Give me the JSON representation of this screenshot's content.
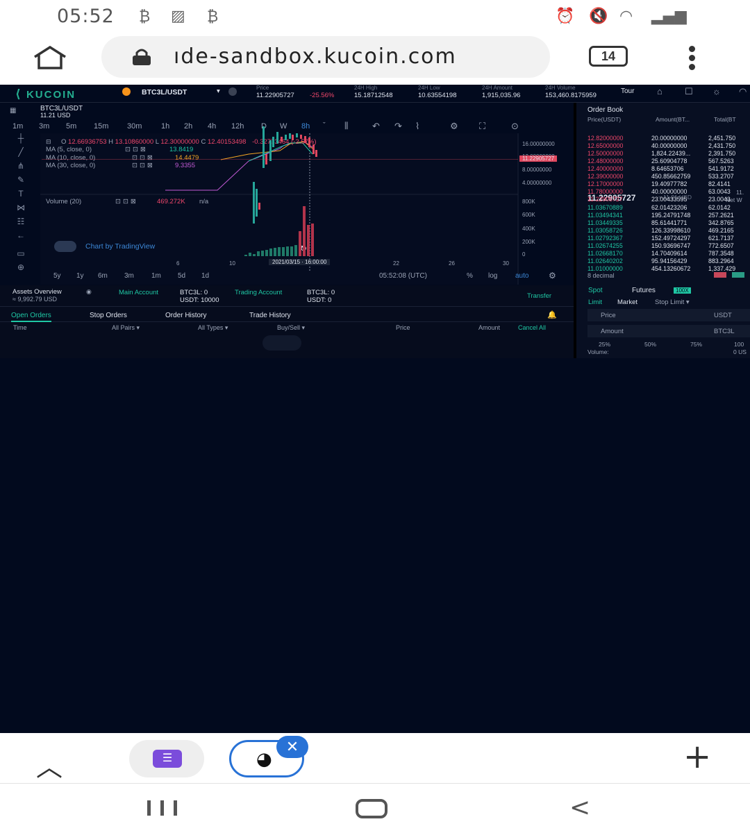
{
  "status_bar": {
    "time": "05:52",
    "icons": [
      "bitcoin-icon",
      "image-icon",
      "bitcoin-icon",
      "alarm-icon",
      "mute-icon",
      "wifi-icon",
      "signal-icon",
      "battery-icon"
    ]
  },
  "browser": {
    "url": "ıde-sandbox.kucoin.com",
    "tab_count": "14"
  },
  "header": {
    "brand": "KUCOIN",
    "pair": "BTC3L/USDT",
    "stats": [
      {
        "label": "Price",
        "value": "11.22905727",
        "change": "-25.56%"
      },
      {
        "label": "24H High",
        "value": "15.18712548"
      },
      {
        "label": "24H Low",
        "value": "10.63554198"
      },
      {
        "label": "24H Amount",
        "value": "1,915,035.96"
      },
      {
        "label": "24H Volume",
        "value": "153,460.8175959"
      }
    ],
    "tour": "Tour"
  },
  "chart": {
    "symbol": "BTC3L/USDT",
    "symbol_price": "11.21 USD",
    "intervals": [
      "1m",
      "3m",
      "5m",
      "15m",
      "30m",
      "1h",
      "2h",
      "4h",
      "12h",
      "D",
      "W",
      "8h"
    ],
    "active_interval": "8h",
    "ohlc": {
      "o": "12.66936753",
      "h": "13.10860000",
      "l": "12.30000000",
      "c": "12.40153498",
      "change": "-0.32773464 (-2.57%)"
    },
    "indicators": [
      {
        "label": "MA (5, close, 0)",
        "value": "13.8419",
        "color": "#1fc7a4"
      },
      {
        "label": "MA (10, close, 0)",
        "value": "14.4479",
        "color": "#f5a623"
      },
      {
        "label": "MA (30, close, 0)",
        "value": "9.3355",
        "color": "#c45bd6"
      }
    ],
    "price_scale": [
      "16.00000000",
      "12.00000000",
      "11.22905727",
      "8.00000000",
      "4.00000000"
    ],
    "volume_label": "Volume (20)",
    "volume_value": "469.272K",
    "volume_na": "n/a",
    "volume_scale": [
      "800K",
      "600K",
      "400K",
      "200K",
      "0"
    ],
    "x_ticks": [
      "6",
      "10",
      "2021/03/15 · 16:00:00",
      "22",
      "26",
      "30"
    ],
    "watermark": "Chart by TradingView",
    "ranges": [
      "5y",
      "1y",
      "6m",
      "3m",
      "1m",
      "5d",
      "1d"
    ],
    "clock": "05:52:08 (UTC)",
    "options": [
      "%",
      "log",
      "auto"
    ]
  },
  "orderbook": {
    "title": "Order Book",
    "headers": [
      "Price(USDT)",
      "Amount(BT...",
      "Total(BT"
    ],
    "asks": [
      [
        "12.82000000",
        "20.00000000",
        "2,451.750"
      ],
      [
        "12.65000000",
        "40.00000000",
        "2,431.750"
      ],
      [
        "12.50000000",
        "1,824.22439...",
        "2,391.750"
      ],
      [
        "12.48000000",
        "25.60904778",
        "567.5263"
      ],
      [
        "12.40000000",
        "8.64653706",
        "541.9172"
      ],
      [
        "12.39000000",
        "450.85662759",
        "533.2707"
      ],
      [
        "12.17000000",
        "19.40977782",
        "82.4141"
      ],
      [
        "11.78000000",
        "40.00000000",
        "63.0043"
      ],
      [
        "11.22905727",
        "23.00433595",
        "23.0043"
      ]
    ],
    "mid_price": "11.22905727",
    "mid_usd": "≈ 11.21 USD",
    "mid_extra": [
      "11.",
      "Net W"
    ],
    "bids": [
      [
        "11.03670889",
        "62.01423206",
        "62.0142"
      ],
      [
        "11.03494341",
        "195.24791748",
        "257.2621"
      ],
      [
        "11.03449335",
        "85.61441771",
        "342.8765"
      ],
      [
        "11.03058726",
        "126.33998610",
        "469.2165"
      ],
      [
        "11.02792367",
        "152.49724297",
        "621.7137"
      ],
      [
        "11.02674255",
        "150.93696747",
        "772.6507"
      ],
      [
        "11.02668170",
        "14.70409614",
        "787.3548"
      ],
      [
        "11.02640202",
        "95.94156429",
        "883.2964"
      ],
      [
        "11.01000000",
        "454.13260672",
        "1,337.429"
      ]
    ],
    "decimal": "8 decimal"
  },
  "assets": {
    "title": "Assets Overview",
    "total": "≈ 9,992.79 USD",
    "main_account": "Main Account",
    "main_btc3l": "BTC3L: 0",
    "main_usdt": "USDT: 10000",
    "trading_account": "Trading Account",
    "trading_btc3l": "BTC3L: 0",
    "trading_usdt": "USDT: 0",
    "transfer": "Transfer"
  },
  "orders": {
    "tabs": [
      "Open Orders",
      "Stop Orders",
      "Order History",
      "Trade History"
    ],
    "columns": [
      "Time",
      "All Pairs",
      "All Types",
      "Buy/Sell",
      "Price",
      "Amount",
      "Cancel All"
    ]
  },
  "trade_form": {
    "spot": "Spot",
    "futures": "Futures",
    "futures_badge": "100X",
    "order_types": [
      "Limit",
      "Market",
      "Stop Limit"
    ],
    "price_label": "Price",
    "price_unit": "USDT",
    "amount_label": "Amount",
    "amount_unit": "BTC3L",
    "percents": [
      "25%",
      "50%",
      "75%",
      "100"
    ],
    "volume_label": "Volume:",
    "volume_value": "0 US"
  },
  "bottom_nav": {
    "up": "^",
    "plus": "+"
  },
  "chart_data": {
    "type": "candlestick",
    "x_ticks": [
      "6",
      "10",
      "22",
      "26",
      "30"
    ],
    "last_price": 11.22905727,
    "volume_bars": [
      20,
      60,
      30,
      80,
      90,
      100,
      120,
      130,
      140,
      140,
      150,
      160,
      180,
      400,
      800,
      500,
      520
    ]
  }
}
